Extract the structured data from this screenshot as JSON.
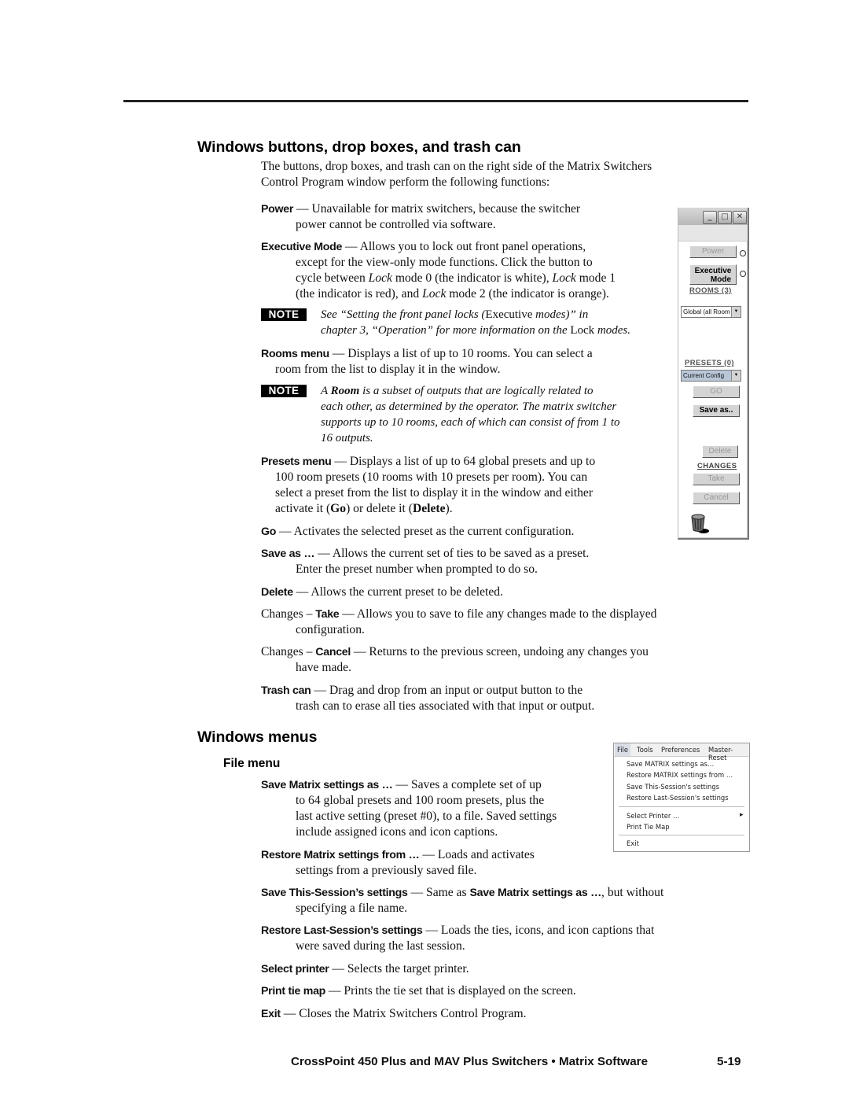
{
  "section1": {
    "heading": "Windows buttons, drop boxes, and trash can",
    "intro_line1": "The buttons, drop boxes, and trash can on the right side of the Matrix Switchers",
    "intro_line2": "Control Program window perform the following functions:",
    "entries": {
      "power": {
        "term": "Power",
        "sep": " — ",
        "line1": "Unavailable for matrix switchers, because the switcher",
        "line2": "power cannot be controlled via software."
      },
      "executive": {
        "term": "Executive Mode",
        "sep": " — ",
        "line1": "Allows you to lock out front panel operations,",
        "line2": "except for the view-only mode functions.  Click the button to",
        "line3a": "cycle between ",
        "lock": "Lock",
        "line3b": " mode 0 (the indicator is white), ",
        "line3c": " mode 1",
        "line4a": "(the indicator is red), and ",
        "line4b": " mode 2 (the indicator is orange)."
      },
      "note1": {
        "badge": "NOTE",
        "a": "See “Setting the front panel locks (",
        "exec": "Executive",
        "b": " modes)” in",
        "c": "chapter 3, “Operation” for more information on the ",
        "lock": "Lock",
        "d": " modes."
      },
      "rooms": {
        "term": "Rooms menu",
        "sep": " — ",
        "line1": "Displays a list of up to 10 rooms.  You can select a",
        "line2": "room from the list to display it in the window."
      },
      "note2": {
        "badge": "NOTE",
        "a": "A ",
        "room": "Room",
        "b": " is a subset of outputs that are logically related to",
        "line2": "each other, as determined by the operator.  The matrix switcher",
        "line3": "supports up to 10 rooms, each of which can consist of from 1 to",
        "line4": "16 outputs."
      },
      "presets": {
        "term": "Presets menu",
        "sep": " — ",
        "line1": "Displays a list of up to 64 global presets and up to",
        "line2": "100 room presets (10 rooms with 10 presets per room).  You can",
        "line3": "select a preset from the list to display it in the window and either",
        "line4a": "activate it (",
        "go": "Go",
        "line4b": ") or delete it (",
        "del": "Delete",
        "line4c": ")."
      },
      "go": {
        "term": "Go",
        "sep": " — ",
        "text": "Activates the selected preset as the current configuration."
      },
      "saveas": {
        "term": "Save as …",
        "sep": " — ",
        "line1": "Allows the current set of ties to be saved as a preset.",
        "line2": "Enter the preset number when prompted to do so."
      },
      "delete": {
        "term": "Delete",
        "sep": " — ",
        "text": "Allows the current preset to be deleted."
      },
      "take": {
        "pre": "Changes – ",
        "term": "Take",
        "sep": " — ",
        "line1": "Allows you to save to file any changes made to the displayed",
        "line2": "configuration."
      },
      "cancel": {
        "pre": "Changes – ",
        "term": "Cancel",
        "sep": " — ",
        "line1": "Returns to the previous screen, undoing any changes you",
        "line2": "have made."
      },
      "trash": {
        "term": "Trash can",
        "sep": " — ",
        "line1": "Drag and drop from an input or output button to the",
        "line2": "trash can to erase all ties associated with that input or output."
      }
    }
  },
  "panel": {
    "window_buttons": {
      "minimize": "_",
      "maximize": "□",
      "close": "✕"
    },
    "power_button": "Power",
    "executive_button_line1": "Executive",
    "executive_button_line2": "Mode",
    "rooms_label": "ROOMS (3)",
    "rooms_combo": "Global (all Room",
    "presets_label": "PRESETS (0)",
    "presets_combo": "Current Config",
    "go_button": "GO",
    "saveas_button": "Save as..",
    "delete_button": "Delete",
    "changes_label": "CHANGES",
    "take_button": "Take",
    "cancel_button": "Cancel",
    "combo_arrow": "▼",
    "indicator_colors": {
      "power": "#ffffff",
      "executive": "#ffffff"
    }
  },
  "section2": {
    "heading": "Windows menus",
    "subheading": "File menu",
    "entries": {
      "save_matrix": {
        "term": "Save Matrix settings as …",
        "sep": " — ",
        "line1": "Saves a complete set of up",
        "line2": "to 64 global presets and 100 room presets, plus the",
        "line3": "last active setting (preset #0), to a file.  Saved settings",
        "line4": "include assigned icons and icon captions."
      },
      "restore_matrix": {
        "term": "Restore Matrix settings from …",
        "sep": " — ",
        "line1": "Loads and activates",
        "line2": "settings from a previously saved file."
      },
      "save_session": {
        "term": "Save This-Session’s settings",
        "sep": " — ",
        "a": "Same as ",
        "ref": "Save Matrix settings as …",
        "b": ", but without",
        "line2": "specifying a file name."
      },
      "restore_session": {
        "term": "Restore Last-Session’s settings",
        "sep": " — ",
        "line1": "Loads the ties, icons, and icon captions that",
        "line2": "were saved during the last session."
      },
      "select_printer": {
        "term": "Select printer",
        "sep": " — ",
        "text": "Selects the target printer."
      },
      "print_tie_map": {
        "term": "Print tie map",
        "sep": " — ",
        "text": "Prints the tie set that is displayed on the screen."
      },
      "exit": {
        "term": "Exit",
        "sep": " — ",
        "text": "Closes the Matrix Switchers Control Program."
      }
    }
  },
  "file_menu": {
    "menubar": [
      "File",
      "Tools",
      "Preferences",
      "Master-Reset"
    ],
    "items": [
      "Save MATRIX settings as…",
      "Restore MATRIX settings from …",
      "Save This-Session's settings",
      "Restore Last-Session's settings",
      "Select Printer …",
      "Print Tie Map",
      "Exit"
    ],
    "submenu_arrow": "▸"
  },
  "footer": {
    "title": "CrossPoint 450 Plus and MAV Plus Switchers • Matrix Software",
    "page_number": "5-19"
  }
}
